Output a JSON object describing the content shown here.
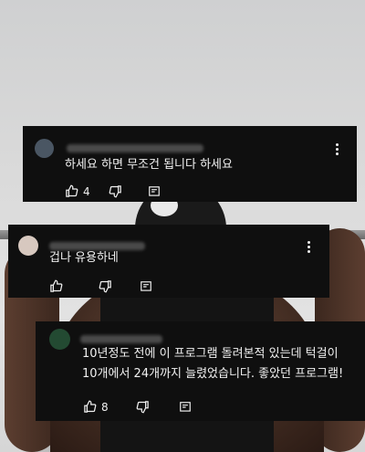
{
  "background": {
    "description_color": "#d9d9d9"
  },
  "comments": [
    {
      "text": "하세요 하면 무조건 됩니다 하세요",
      "like_count": "4",
      "avatar_color": "#4a5663"
    },
    {
      "text": "겁나 유용하네",
      "like_count": "",
      "avatar_color": "#d7c8bf"
    },
    {
      "text_line1": "10년정도 전에 이 프로그램 돌려본적 있는데 턱걸이",
      "text_line2": "10개에서 24개까지 늘렸었습니다. 좋았던 프로그램!",
      "like_count": "8",
      "avatar_color": "#234a32"
    }
  ],
  "icons": {
    "like": "thumb-up-icon",
    "dislike": "thumb-down-icon",
    "reply": "reply-icon",
    "more": "more-vert-icon"
  }
}
